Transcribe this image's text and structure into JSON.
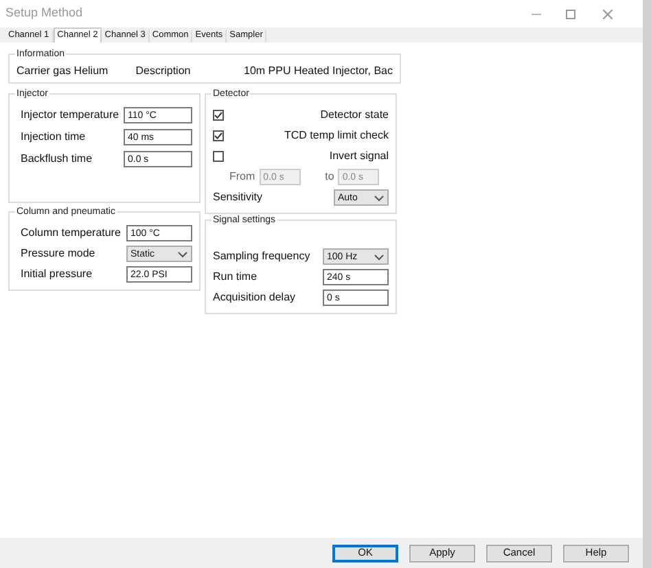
{
  "window": {
    "title": "Setup Method"
  },
  "tabs": [
    {
      "label": "Channel 1",
      "selected": false
    },
    {
      "label": "Channel 2",
      "selected": true
    },
    {
      "label": "Channel 3",
      "selected": false
    },
    {
      "label": "Common",
      "selected": false
    },
    {
      "label": "Events",
      "selected": false
    },
    {
      "label": "Sampler",
      "selected": false
    }
  ],
  "information": {
    "title": "Information",
    "carrier_gas": "Carrier gas Helium",
    "description_label": "Description",
    "description": "10m PPU Heated Injector, Bac"
  },
  "injector": {
    "title": "Injector",
    "fields": [
      {
        "label": "Injector temperature",
        "value": "110 °C"
      },
      {
        "label": "Injection time",
        "value": "40 ms"
      },
      {
        "label": "Backflush time",
        "value": "0.0 s"
      }
    ]
  },
  "detector": {
    "title": "Detector",
    "checks": [
      {
        "label": "Detector state",
        "checked": true
      },
      {
        "label": "TCD temp limit check",
        "checked": true
      },
      {
        "label": "Invert signal",
        "checked": false
      }
    ],
    "from_label": "From",
    "from_value": "0.0 s",
    "to_label": "to",
    "to_value": "0.0 s",
    "sensitivity_label": "Sensitivity",
    "sensitivity": "Auto"
  },
  "column": {
    "title": "Column and pneumatic",
    "fields": [
      {
        "kind": "text",
        "label": "Column temperature",
        "value": "100 °C"
      },
      {
        "kind": "select",
        "label": "Pressure mode",
        "value": "Static"
      },
      {
        "kind": "text",
        "label": "Initial pressure",
        "value": "22.0 PSI"
      }
    ]
  },
  "signal": {
    "title": "Signal settings",
    "fields": [
      {
        "kind": "select",
        "label": "Sampling frequency",
        "value": "100 Hz"
      },
      {
        "kind": "text",
        "label": "Run time",
        "value": "240 s"
      },
      {
        "kind": "text",
        "label": "Acquisition delay",
        "value": "0 s"
      }
    ]
  },
  "buttons": [
    {
      "label": "OK",
      "default": true
    },
    {
      "label": "Apply",
      "default": false
    },
    {
      "label": "Cancel",
      "default": false
    },
    {
      "label": "Help",
      "default": false
    }
  ]
}
